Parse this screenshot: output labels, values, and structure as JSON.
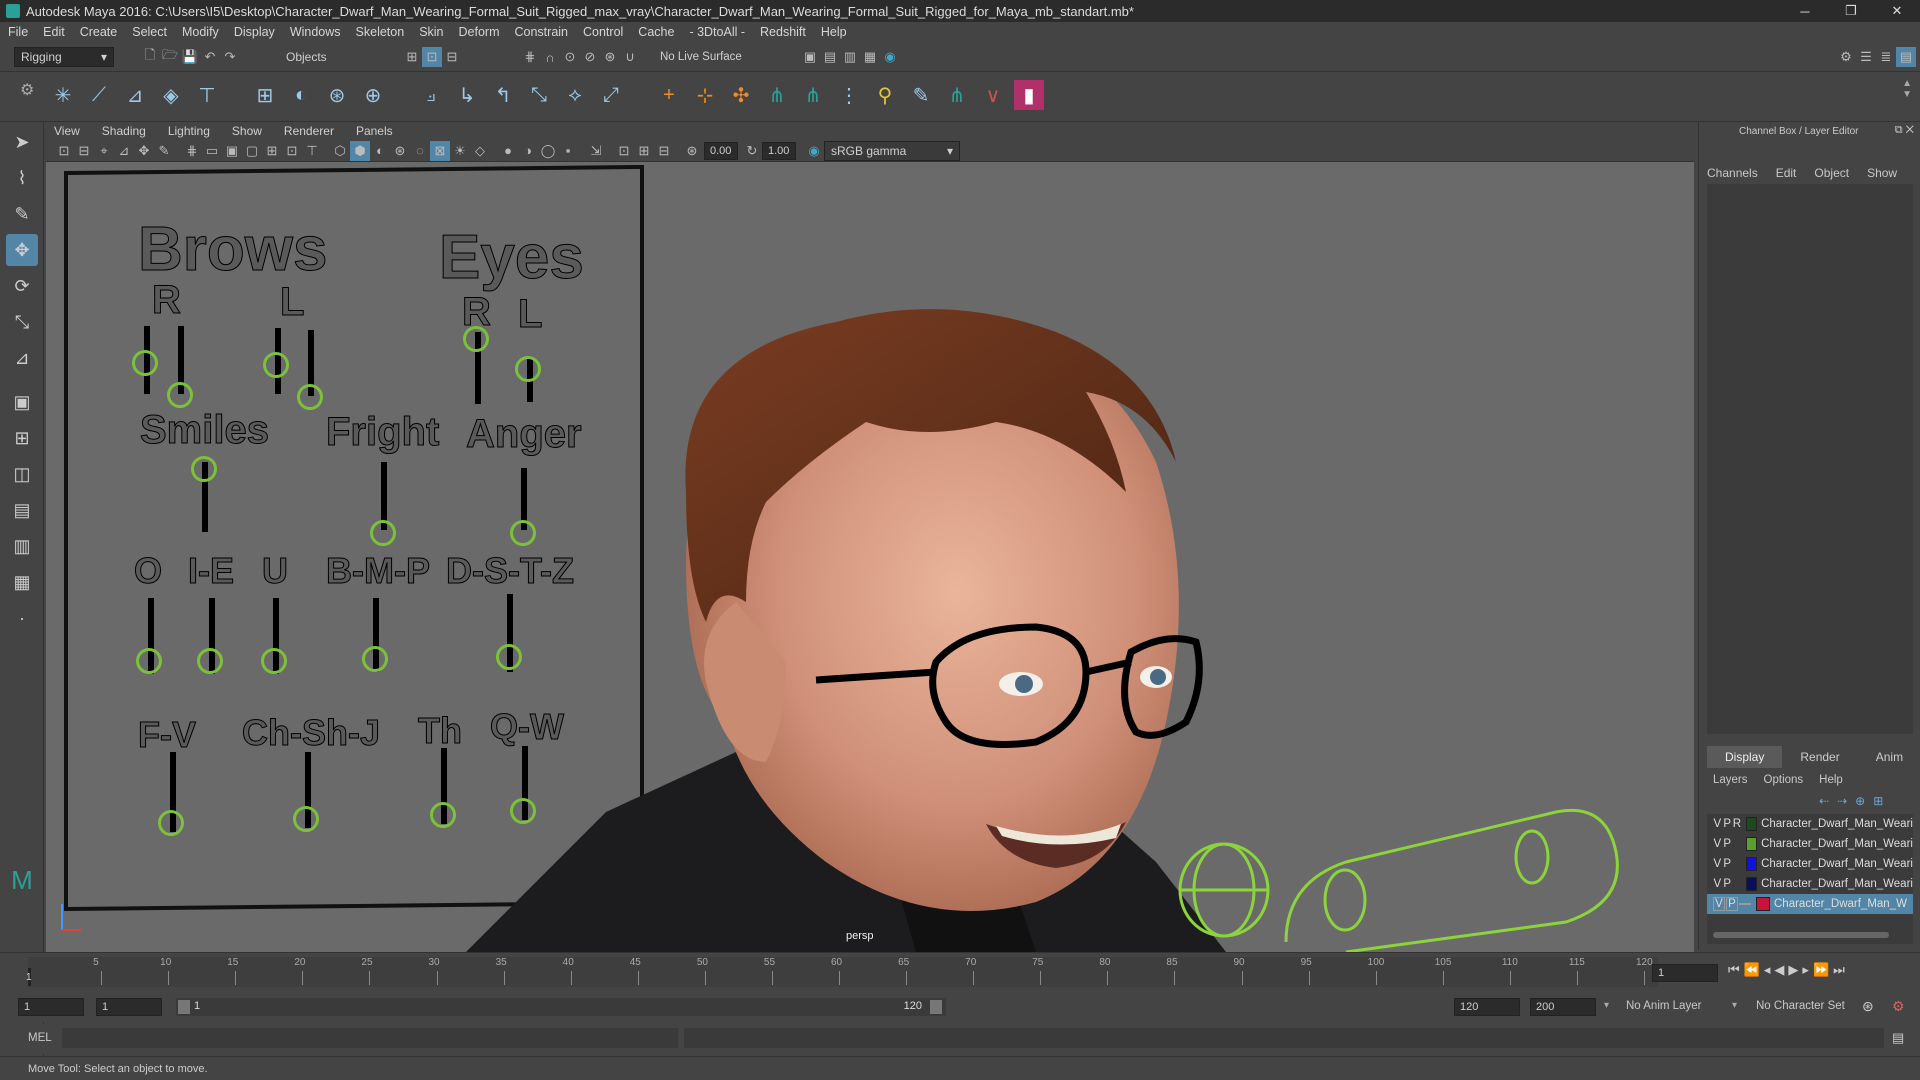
{
  "window": {
    "title": "Autodesk Maya 2016: C:\\Users\\I5\\Desktop\\Character_Dwarf_Man_Wearing_Formal_Suit_Rigged_max_vray\\Character_Dwarf_Man_Wearing_Formal_Suit_Rigged_for_Maya_mb_standart.mb*",
    "minimize": "─",
    "restore": "❐",
    "close": "✕"
  },
  "menubar": [
    "File",
    "Edit",
    "Create",
    "Select",
    "Modify",
    "Display",
    "Windows",
    "Skeleton",
    "Skin",
    "Deform",
    "Constrain",
    "Control",
    "Cache",
    "- 3DtoAll -",
    "Redshift",
    "Help"
  ],
  "statusline": {
    "menuset": "Rigging",
    "selection_mode": "Objects",
    "live_surface": "No Live Surface"
  },
  "panel": {
    "menus": [
      "View",
      "Shading",
      "Lighting",
      "Show",
      "Renderer",
      "Panels"
    ],
    "field1": "0.00",
    "field2": "1.00",
    "color_space": "sRGB gamma",
    "camera_label": "persp"
  },
  "face_controls": {
    "headings": {
      "brows": "Brows",
      "eyes": "Eyes",
      "smiles": "Smiles",
      "fright": "Fright",
      "anger": "Anger"
    },
    "brows_r": "R",
    "brows_l": "L",
    "eyes_r": "R",
    "eyes_l": "L",
    "phonemes": [
      "O",
      "I-E",
      "U",
      "B-M-P",
      "D-S-T-Z"
    ],
    "phonemes2": [
      "F-V",
      "Ch-Sh-J",
      "Th",
      "Q-W"
    ]
  },
  "channel_box": {
    "title": "Channel Box / Layer Editor",
    "menus": [
      "Channels",
      "Edit",
      "Object",
      "Show"
    ]
  },
  "layer_editor": {
    "tabs": [
      "Display",
      "Render",
      "Anim"
    ],
    "menus": [
      "Layers",
      "Options",
      "Help"
    ],
    "layers": [
      {
        "v": "V",
        "p": "P",
        "r": "R",
        "color": "#1d4a1d",
        "name": "Character_Dwarf_Man_Weari"
      },
      {
        "v": "V",
        "p": "P",
        "r": "",
        "color": "#5aa02c",
        "name": "Character_Dwarf_Man_Weari"
      },
      {
        "v": "V",
        "p": "P",
        "r": "",
        "color": "#1010e0",
        "name": "Character_Dwarf_Man_Weari"
      },
      {
        "v": "V",
        "p": "P",
        "r": "",
        "color": "#0d0d60",
        "name": "Character_Dwarf_Man_Weari"
      },
      {
        "v": "V",
        "p": "P",
        "r": "",
        "color": "#c8143c",
        "name": "Character_Dwarf_Man_W",
        "selected": true
      }
    ]
  },
  "timeline": {
    "ticks": [
      "5",
      "10",
      "15",
      "20",
      "25",
      "30",
      "35",
      "40",
      "45",
      "50",
      "55",
      "60",
      "65",
      "70",
      "75",
      "80",
      "85",
      "90",
      "95",
      "100",
      "105",
      "110",
      "115",
      "120"
    ],
    "current_frame": "1",
    "start_marker": "1"
  },
  "range": {
    "start": "1",
    "playback_start": "1",
    "slider_start": "1",
    "slider_end": "120",
    "playback_end": "120",
    "end": "200",
    "anim_layer": "No Anim Layer",
    "char_set": "No Character Set"
  },
  "cmdline": {
    "label": "MEL"
  },
  "helpline": {
    "text": "Move Tool: Select an object to move."
  }
}
